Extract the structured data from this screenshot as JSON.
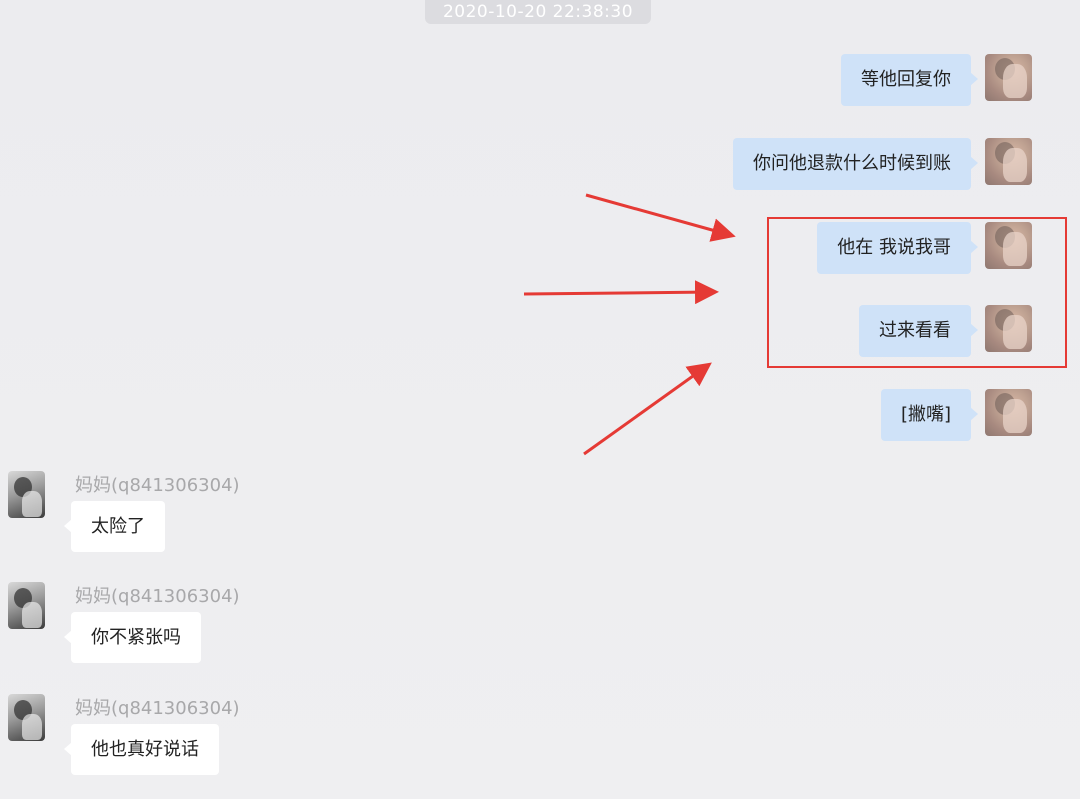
{
  "timestamp": "2020-10-20 22:38:30",
  "outgoing_messages": [
    {
      "text": "等他回复你"
    },
    {
      "text": "你问他退款什么时候到账"
    },
    {
      "text": "他在 我说我哥"
    },
    {
      "text": "过来看看"
    },
    {
      "text": "[撇嘴]"
    }
  ],
  "incoming_messages": [
    {
      "sender": "妈妈(q841306304)",
      "text": "太险了"
    },
    {
      "sender": "妈妈(q841306304)",
      "text": "你不紧张吗"
    },
    {
      "sender": "妈妈(q841306304)",
      "text": "他也真好说话"
    }
  ],
  "colors": {
    "outgoing_bubble": "#cfe2f8",
    "incoming_bubble": "#ffffff",
    "annotation_red": "#e53a35"
  }
}
